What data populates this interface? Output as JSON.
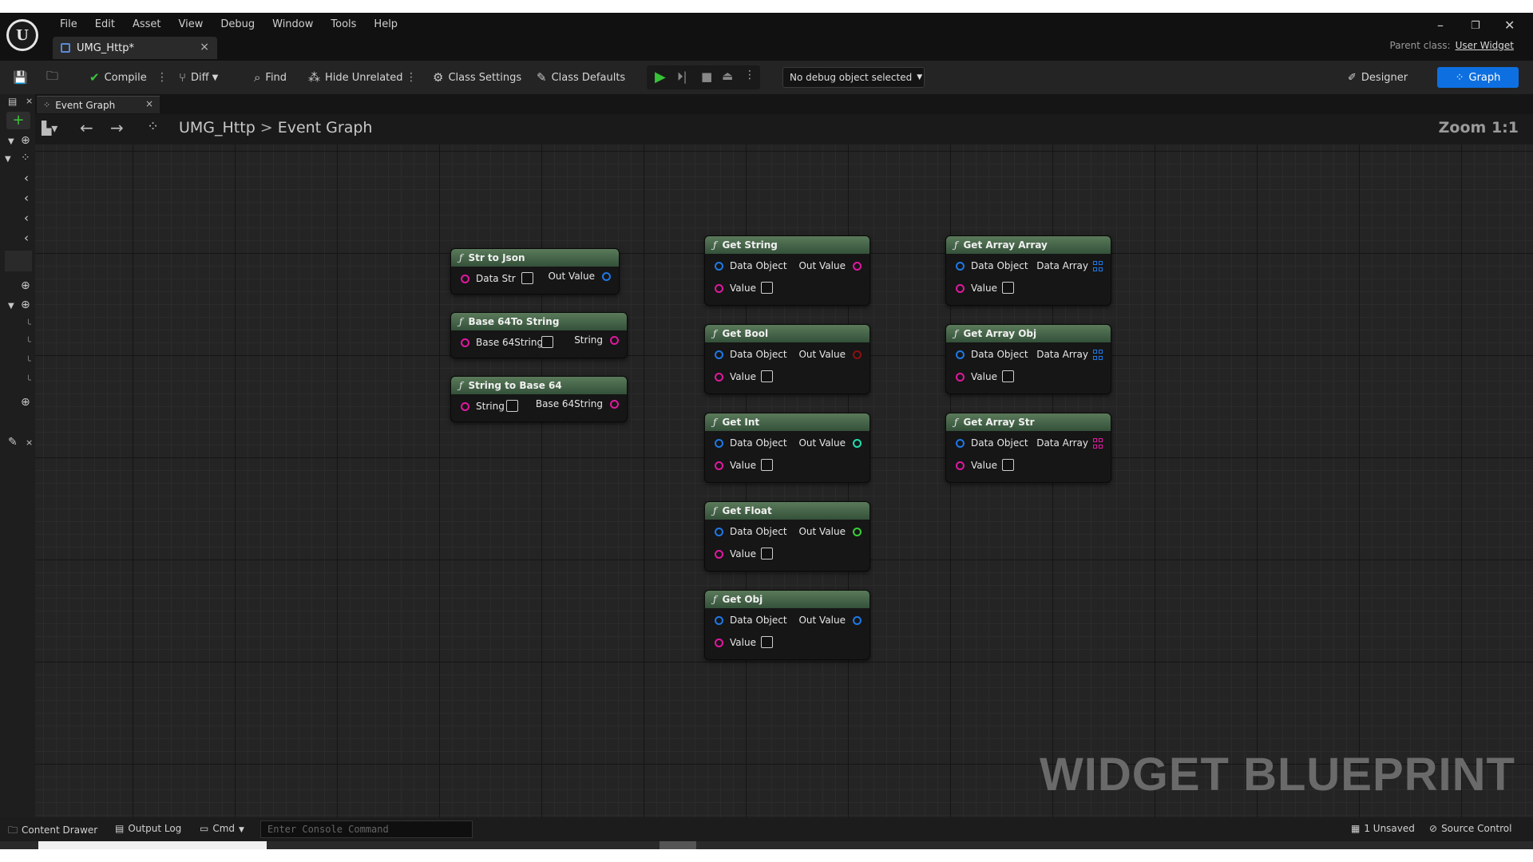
{
  "menu": [
    "File",
    "Edit",
    "Asset",
    "View",
    "Debug",
    "Window",
    "Tools",
    "Help"
  ],
  "doc_tab": {
    "label": "UMG_Http*",
    "close": "×"
  },
  "parent_class": {
    "label": "Parent class:",
    "value": "User Widget"
  },
  "window_controls": {
    "minimize": "–",
    "restore": "❐",
    "close": "✕"
  },
  "toolbar": {
    "compile": "Compile",
    "diff": "Diff",
    "find": "Find",
    "hide_unrelated": "Hide Unrelated",
    "class_settings": "Class Settings",
    "class_defaults": "Class Defaults",
    "debug_select": "No debug object selected",
    "designer": "Designer",
    "graph": "Graph"
  },
  "graph_tab": {
    "label": "Event Graph",
    "close": "×"
  },
  "breadcrumb": {
    "root": "UMG_Http",
    "sep": ">",
    "current": "Event Graph"
  },
  "zoom": "Zoom 1:1",
  "watermark": "WIDGET BLUEPRINT",
  "nodes": {
    "str_to_json": {
      "title": "Str to Json",
      "in": "Data Str",
      "out": "Out Value"
    },
    "base64_to_string": {
      "title": "Base 64To String",
      "in": "Base 64String",
      "out": "String"
    },
    "string_to_base64": {
      "title": "String to Base 64",
      "in": "String",
      "out": "Base 64String"
    },
    "get_string": {
      "title": "Get String",
      "in": "Data Object",
      "out": "Out Value",
      "value": "Value"
    },
    "get_bool": {
      "title": "Get Bool",
      "in": "Data Object",
      "out": "Out Value",
      "value": "Value"
    },
    "get_int": {
      "title": "Get Int",
      "in": "Data Object",
      "out": "Out Value",
      "value": "Value"
    },
    "get_float": {
      "title": "Get Float",
      "in": "Data Object",
      "out": "Out Value",
      "value": "Value"
    },
    "get_obj": {
      "title": "Get Obj",
      "in": "Data Object",
      "out": "Out Value",
      "value": "Value"
    },
    "get_array_array": {
      "title": "Get Array Array",
      "in": "Data Object",
      "out": "Data Array",
      "value": "Value"
    },
    "get_array_obj": {
      "title": "Get Array Obj",
      "in": "Data Object",
      "out": "Data Array",
      "value": "Value"
    },
    "get_array_str": {
      "title": "Get Array Str",
      "in": "Data Object",
      "out": "Data Array",
      "value": "Value"
    }
  },
  "statusbar": {
    "content_drawer": "Content Drawer",
    "output_log": "Output Log",
    "cmd": "Cmd",
    "console_placeholder": "Enter Console Command",
    "unsaved": "1 Unsaved",
    "source_control": "Source Control"
  },
  "colors": {
    "accent": "#0e70e0",
    "pin_string": "#e018a0",
    "pin_object": "#1e78e6",
    "pin_bool": "#8c1010",
    "pin_int": "#20e0b0",
    "pin_float": "#38d038",
    "node_header": "#4a6a4a"
  }
}
